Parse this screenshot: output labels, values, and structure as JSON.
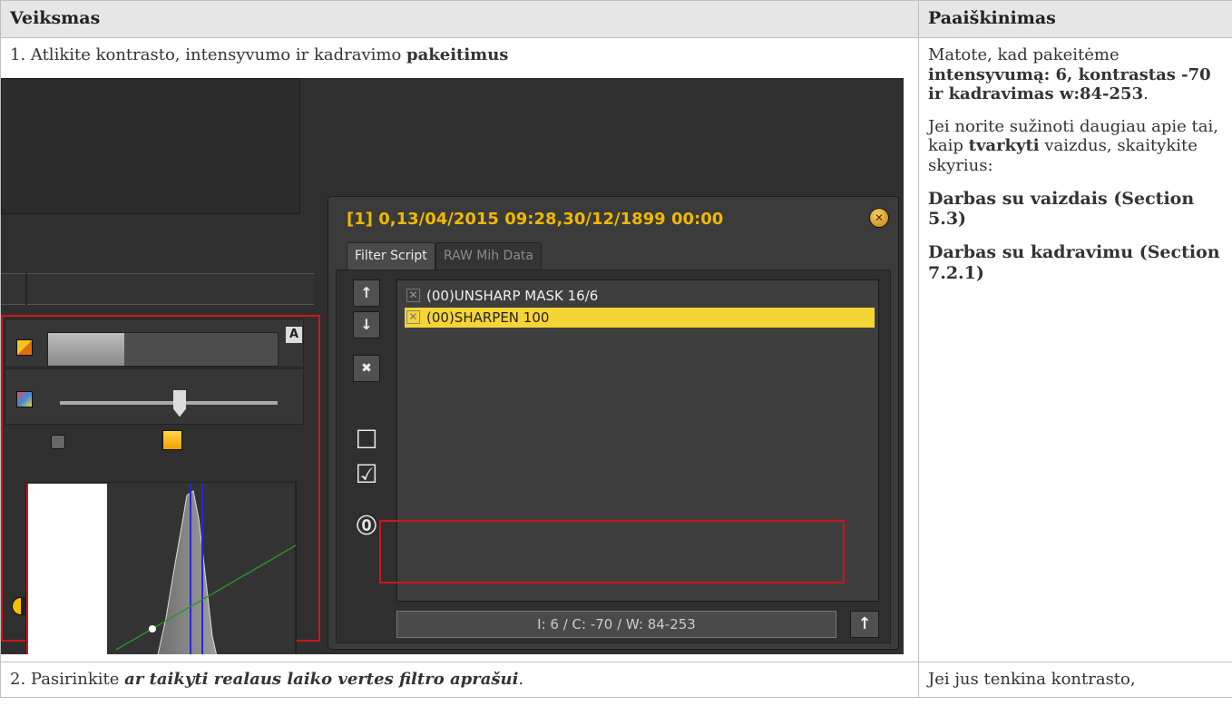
{
  "table": {
    "headers": {
      "action": "Veiksmas",
      "explanation": "Paaiškinimas"
    },
    "row1": {
      "step_prefix": "1. Atlikite kontrasto, intensyvumo ir kadravimo ",
      "step_bold": "pakeitimus",
      "expl_p1_a": "Matote, kad pakeitėme ",
      "expl_p1_b": "intensyvumą: 6, kontrastas -70 ir kadravimas w:84-253",
      "expl_p1_c": ".",
      "expl_p2_a": "Jei norite sužinoti daugiau apie tai, kaip ",
      "expl_p2_b": "tvarkyti",
      "expl_p2_c": " vaizdus, skaitykite skyrius:",
      "link1": "Darbas su vaizdais (Section 5.3)",
      "link2": "Darbas su kadravimu (Section 7.2.1)"
    },
    "row2": {
      "step_prefix": "2. Pasirinkite ",
      "step_bold": "ar taikyti realaus laiko vertes filtro aprašui",
      "step_suffix": ".",
      "expl": "Jei jus tenkina kontrasto,"
    }
  },
  "screenshot": {
    "dialog_title": "[1] 0,13/04/2015 09:28,30/12/1899 00:00",
    "tabs": [
      "Filter Script",
      "RAW Mih Data"
    ],
    "filters": [
      {
        "label": "(00)UNSHARP MASK 16/6",
        "selected": false
      },
      {
        "label": "(00)SHARPEN 100",
        "selected": true
      }
    ],
    "status_text": "I: 6 / C: -70 / W: 84-253",
    "a_button": "A",
    "histogram": {
      "intensity": 6,
      "contrast": -70,
      "window_min": 84,
      "window_max": 253
    },
    "colors": {
      "title": "#f0b800",
      "selection": "#f5d535",
      "highlight_box": "#d0151a"
    }
  }
}
